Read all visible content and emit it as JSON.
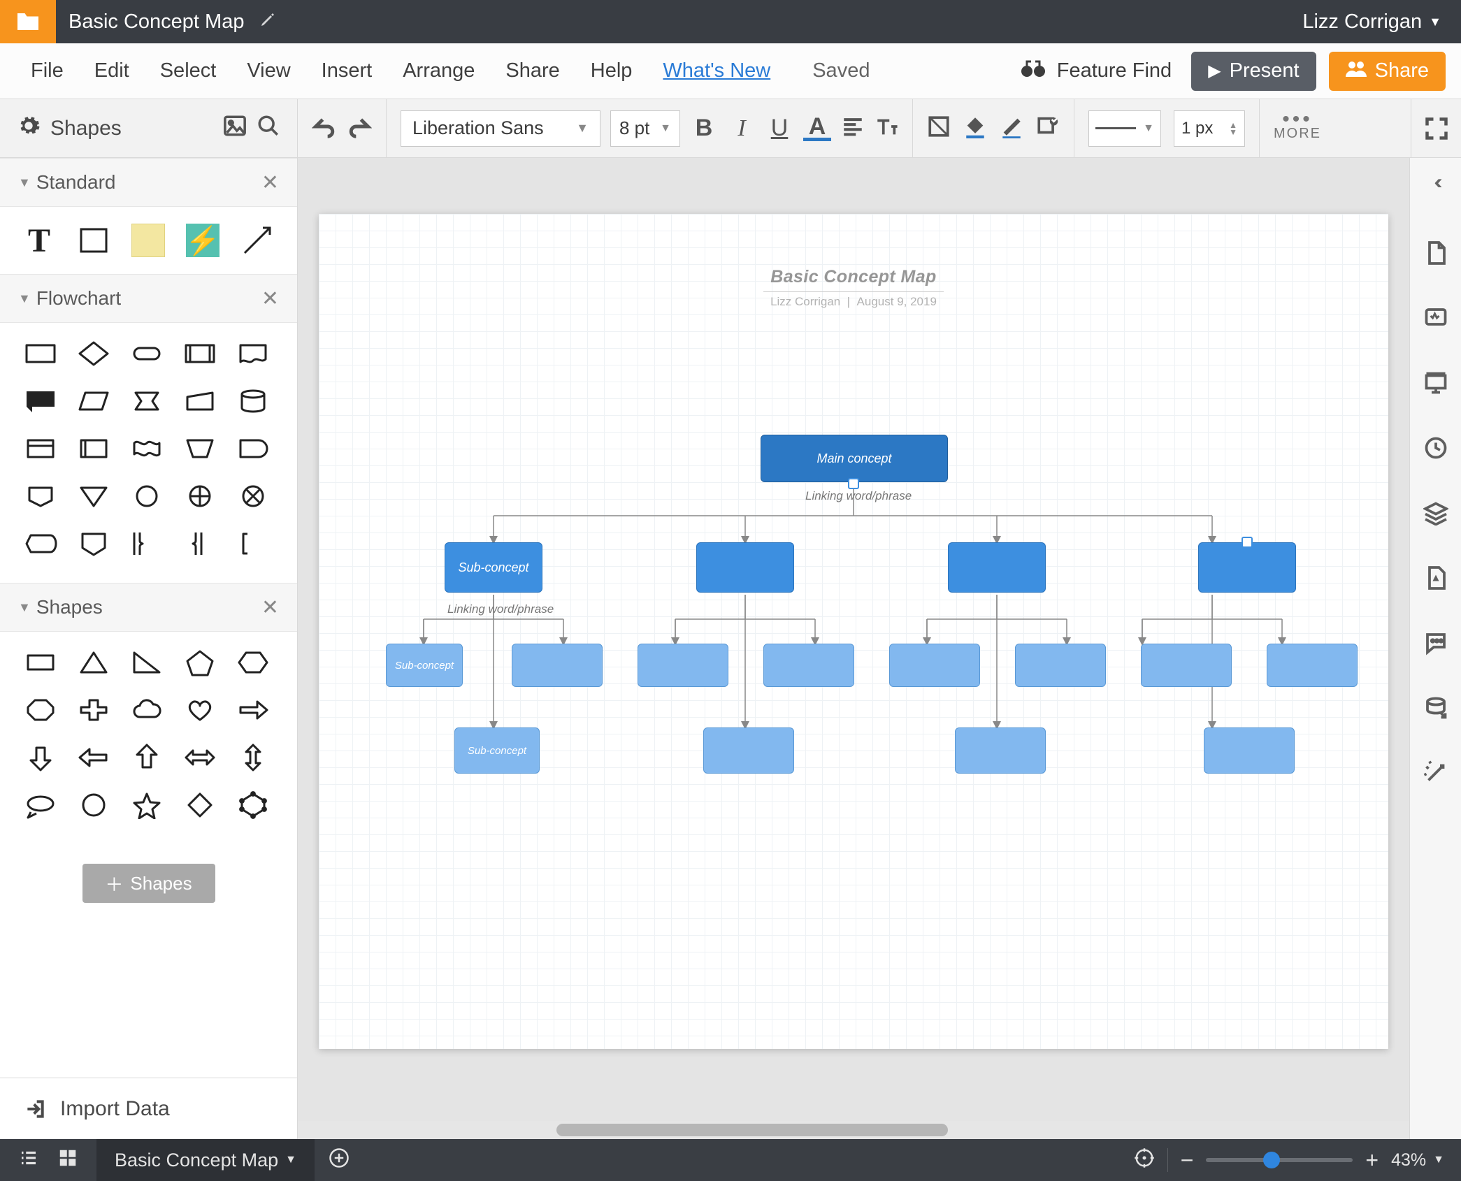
{
  "brand": {
    "orange": "#f7941d"
  },
  "titlebar": {
    "doc_title": "Basic Concept Map",
    "user": "Lizz Corrigan"
  },
  "menubar": {
    "items": [
      "File",
      "Edit",
      "Select",
      "View",
      "Insert",
      "Arrange",
      "Share",
      "Help"
    ],
    "whats_new": "What's New",
    "saved": "Saved",
    "feature_find": "Feature Find",
    "present": "Present",
    "share_btn": "Share"
  },
  "toolbar": {
    "shapes_label": "Shapes",
    "font": "Liberation Sans",
    "font_size": "8 pt",
    "line_width": "1 px",
    "more_label": "MORE"
  },
  "panel": {
    "sections": {
      "standard": "Standard",
      "flowchart": "Flowchart",
      "shapes": "Shapes"
    },
    "more_shapes_btn": "Shapes",
    "import_data": "Import Data"
  },
  "canvas": {
    "title": "Basic Concept Map",
    "subtitle_author": "Lizz Corrigan",
    "subtitle_date": "August 9, 2019",
    "main_concept": "Main concept",
    "linking_phrase": "Linking word/phrase",
    "sub_concept": "Sub-concept"
  },
  "footer": {
    "page_tab": "Basic Concept Map",
    "zoom_pct": "43%"
  }
}
